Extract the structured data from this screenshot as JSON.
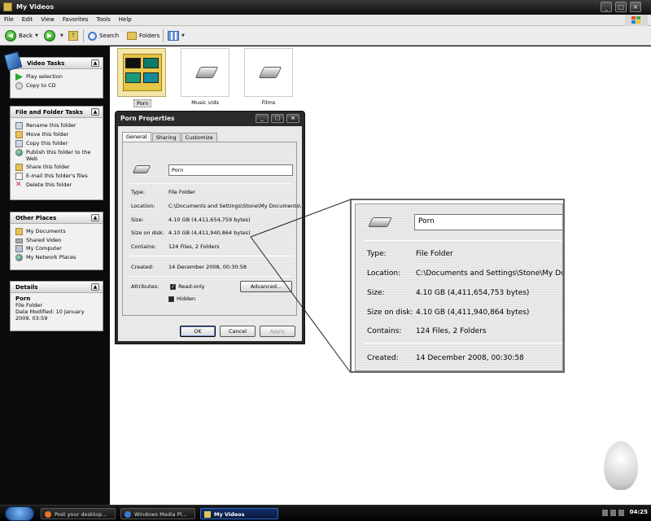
{
  "window": {
    "title": "My Videos",
    "controls": {
      "minimize": "_",
      "maximize": "□",
      "close": "×"
    }
  },
  "menu": [
    "File",
    "Edit",
    "View",
    "Favorites",
    "Tools",
    "Help"
  ],
  "toolbar": {
    "back": "Back",
    "search": "Search",
    "folders": "Folders"
  },
  "sidebar": {
    "video_tasks": {
      "title": "Video Tasks",
      "items": [
        "Play selection",
        "Copy to CD"
      ]
    },
    "file_folder_tasks": {
      "title": "File and Folder Tasks",
      "items": [
        "Rename this folder",
        "Move this folder",
        "Copy this folder",
        "Publish this folder to the Web",
        "Share this folder",
        "E-mail this folder's files",
        "Delete this folder"
      ]
    },
    "other_places": {
      "title": "Other Places",
      "items": [
        "My Documents",
        "Shared Video",
        "My Computer",
        "My Network Places"
      ]
    },
    "details": {
      "title": "Details",
      "name": "Porn",
      "type": "File Folder",
      "modified": "Date Modified: 10 January 2009, 03:59"
    }
  },
  "content": {
    "items": [
      {
        "label": "Porn",
        "selected": true
      },
      {
        "label": "Music vids",
        "selected": false
      },
      {
        "label": "Films",
        "selected": false
      }
    ]
  },
  "dialog": {
    "title": "Porn Properties",
    "tabs": [
      "General",
      "Sharing",
      "Customize"
    ],
    "name_value": "Porn",
    "rows": {
      "type": {
        "label": "Type:",
        "value": "File Folder"
      },
      "location": {
        "label": "Location:",
        "value": "C:\\Documents and Settings\\Stone\\My Documents\\"
      },
      "size": {
        "label": "Size:",
        "value": "4.10 GB (4,411,654,759 bytes)"
      },
      "size_on_disk": {
        "label": "Size on disk:",
        "value": "4.10 GB (4,411,940,864 bytes)"
      },
      "contains": {
        "label": "Contains:",
        "value": "124 Files, 2 Folders"
      },
      "created": {
        "label": "Created:",
        "value": "14 December 2008, 00:30:58"
      },
      "attributes": {
        "label": "Attributes:"
      }
    },
    "attr_readonly": "Read-only",
    "attr_hidden": "Hidden",
    "advanced_button": "Advanced...",
    "ok_button": "OK",
    "cancel_button": "Cancel",
    "apply_button": "Apply"
  },
  "zoom": {
    "name_value": "Porn",
    "type": {
      "label": "Type:",
      "value": "File Folder"
    },
    "location": {
      "label": "Location:",
      "value": "C:\\Documents and Settings\\Stone\\My Docum"
    },
    "size": {
      "label": "Size:",
      "value": "4.10 GB (4,411,654,753 bytes)"
    },
    "size_on_disk": {
      "label": "Size on disk:",
      "value": "4.10 GB (4,411,940,864 bytes)"
    },
    "contains": {
      "label": "Contains:",
      "value": "124 Files, 2 Folders"
    },
    "created": {
      "label": "Created:",
      "value": "14 December 2008, 00:30:58"
    }
  },
  "taskbar": {
    "tasks": [
      {
        "label": "Post your desktop...",
        "active": false
      },
      {
        "label": "Windows Media Pl...",
        "active": false
      },
      {
        "label": "My Videos",
        "active": true
      }
    ],
    "clock": "04:25"
  },
  "colors": {
    "window_chrome": "#1a1a1a",
    "selection_folder": "#f4e7a7",
    "taskbar_active": "#12306a"
  }
}
